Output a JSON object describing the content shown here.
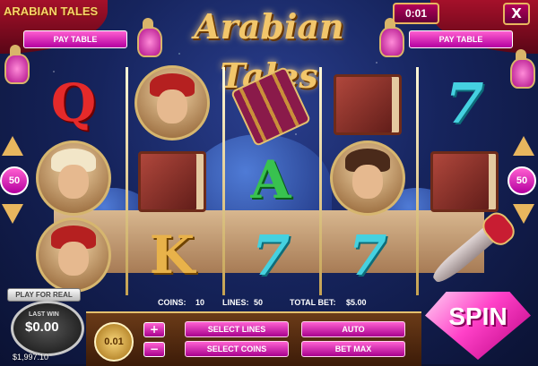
{
  "header": {
    "brand": "ARABIAN TALES",
    "title": "Arabian Tales",
    "timer": "0:01",
    "close": "X",
    "paytable_left": "PAY TABLE",
    "paytable_right": "PAY TABLE"
  },
  "sides": {
    "left_lines": "50",
    "right_lines": "50"
  },
  "reels": [
    [
      "Q",
      "wise-man",
      "pirate"
    ],
    [
      "pirate-sword",
      "book",
      "K"
    ],
    [
      "carpet",
      "A",
      "7"
    ],
    [
      "book",
      "princess",
      "7"
    ],
    [
      "7",
      "book",
      "dagger"
    ]
  ],
  "info": {
    "coins_label": "COINS:",
    "coins": "10",
    "lines_label": "LINES:",
    "lines": "50",
    "totalbet_label": "TOTAL BET:",
    "totalbet": "$5.00"
  },
  "panel": {
    "coin_value": "0.01",
    "plus": "+",
    "minus": "−",
    "select_lines": "SELECT LINES",
    "select_coins": "SELECT COINS",
    "auto": "AUTO",
    "bet_max": "BET MAX"
  },
  "balance": {
    "play_for_real": "PLAY FOR REAL",
    "last_win_label": "LAST WIN",
    "last_win": "$0.00",
    "balance": "$1,997.10"
  },
  "spin": "SPIN",
  "colors": {
    "accent_pink": "#ff41c8",
    "gold": "#e8b65e",
    "sky": "#16245d"
  }
}
